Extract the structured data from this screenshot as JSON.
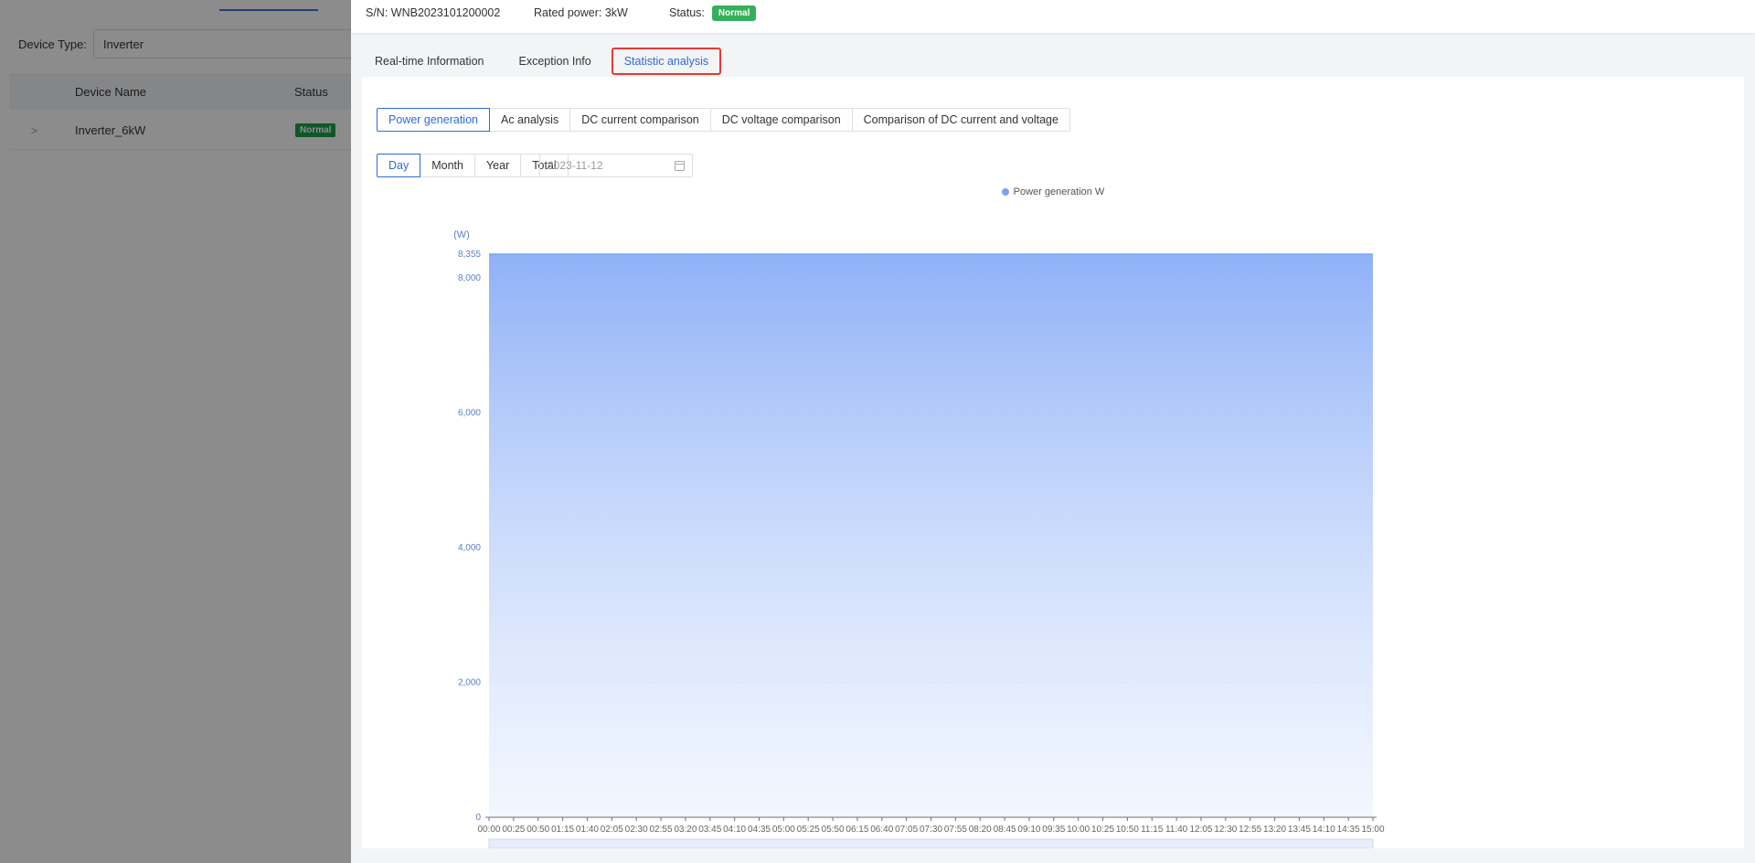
{
  "background": {
    "filter_label": "Device Type:",
    "filter_value": "Inverter",
    "table_headers": [
      "Device Name",
      "Status"
    ],
    "rows": [
      {
        "expand": ">",
        "name": "Inverter_6kW",
        "status": "Normal"
      }
    ]
  },
  "header": {
    "sn_label": "S/N:",
    "sn_value": "WNB2023101200002",
    "rated_power_label": "Rated power:",
    "rated_power_value": "3kW",
    "status_label": "Status:",
    "status_value": "Normal"
  },
  "tabs": [
    {
      "label": "Real-time Information",
      "active": false
    },
    {
      "label": "Exception Info",
      "active": false
    },
    {
      "label": "Statistic analysis",
      "active": true
    }
  ],
  "analysis_types": [
    {
      "label": "Power generation",
      "active": true
    },
    {
      "label": "Ac analysis",
      "active": false
    },
    {
      "label": "DC current comparison",
      "active": false
    },
    {
      "label": "DC voltage comparison",
      "active": false
    },
    {
      "label": "Comparison of DC current and voltage",
      "active": false
    }
  ],
  "periods": [
    {
      "label": "Day",
      "active": true
    },
    {
      "label": "Month",
      "active": false
    },
    {
      "label": "Year",
      "active": false
    },
    {
      "label": "Total",
      "active": false
    }
  ],
  "date_picker": {
    "value": "2023-11-12",
    "icon": "calendar-icon"
  },
  "colors": {
    "accent": "#2f6bd6",
    "status_normal": "#35b05a",
    "area_top": "#8fb1f7",
    "highlight": "#e53935"
  },
  "chart_data": {
    "type": "area",
    "legend": "Power generation W",
    "ylabel": "(W)",
    "ylim": [
      0,
      8355
    ],
    "yticks": [
      0,
      2000,
      4000,
      6000,
      8000,
      8355
    ],
    "ytick_labels": [
      "0",
      "2,000",
      "4,000",
      "6,000",
      "8,000",
      "8,355"
    ],
    "x": [
      "00:00",
      "00:25",
      "00:50",
      "01:15",
      "01:40",
      "02:05",
      "02:30",
      "02:55",
      "03:20",
      "03:45",
      "04:10",
      "04:35",
      "05:00",
      "05:25",
      "05:50",
      "06:15",
      "06:40",
      "07:05",
      "07:30",
      "07:55",
      "08:20",
      "08:45",
      "09:10",
      "09:35",
      "10:00",
      "10:25",
      "10:50",
      "11:15",
      "11:40",
      "12:05",
      "12:30",
      "12:55",
      "13:20",
      "13:45",
      "14:10",
      "14:35",
      "15:00"
    ],
    "series": [
      {
        "name": "Power generation W",
        "values": [
          8355,
          8355,
          8355,
          8355,
          8355,
          8355,
          8355,
          8355,
          8355,
          8355,
          8355,
          8355,
          8355,
          8355,
          8355,
          8355,
          8355,
          8355,
          8355,
          8355,
          8355,
          8355,
          8355,
          8355,
          8355,
          8355,
          8355,
          8355,
          8355,
          8355,
          8355,
          8355,
          8355,
          8355,
          8355,
          8355,
          8355
        ]
      }
    ],
    "grid": true,
    "legend_position": "top-center"
  }
}
